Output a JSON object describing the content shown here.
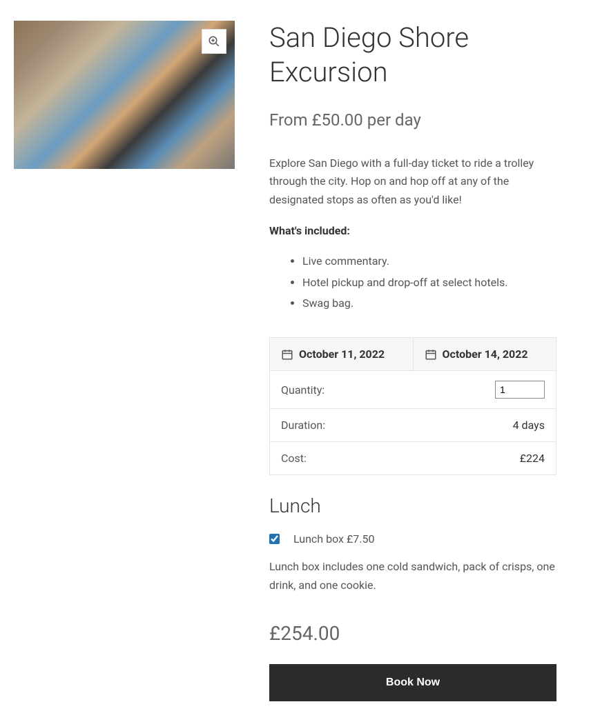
{
  "product": {
    "title": "San Diego Shore Excursion",
    "price_line": "From £50.00 per day",
    "description": "Explore San Diego with a full-day ticket to ride a trolley through the city. Hop on and hop off at any of the designated stops as often as you'd like!",
    "included_label": "What's included:",
    "included": [
      "Live commentary.",
      "Hotel pickup and drop-off at select hotels.",
      "Swag bag."
    ]
  },
  "booking": {
    "date_start": "October 11, 2022",
    "date_end": "October 14, 2022",
    "rows": {
      "quantity_label": "Quantity:",
      "quantity_value": "1",
      "duration_label": "Duration:",
      "duration_value": "4 days",
      "cost_label": "Cost:",
      "cost_value": "£224"
    }
  },
  "addon": {
    "heading": "Lunch",
    "checkbox_label": "Lunch box £7.50",
    "checked": true,
    "description": "Lunch box includes one cold sandwich, pack of crisps, one drink, and one cookie."
  },
  "total": "£254.00",
  "cta": "Book Now"
}
